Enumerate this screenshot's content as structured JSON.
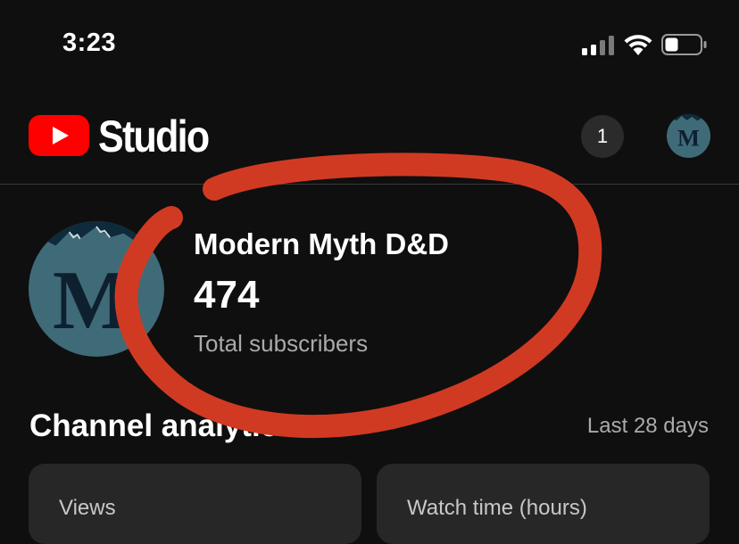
{
  "status_bar": {
    "time": "3:23"
  },
  "header": {
    "app_name": "Studio",
    "notification_count": "1",
    "avatar_letter": "M"
  },
  "channel": {
    "name": "Modern Myth D&D",
    "subscriber_count": "474",
    "subscriber_label": "Total subscribers",
    "avatar_letter": "M"
  },
  "analytics": {
    "title": "Channel analytics",
    "period": "Last 28 days",
    "cards": [
      {
        "label": "Views"
      },
      {
        "label": "Watch time (hours)"
      }
    ]
  },
  "colors": {
    "background": "#0f0f0f",
    "youtube_red": "#ff0000",
    "annotation_red": "#d13a22",
    "card_bg": "#272727",
    "avatar_teal": "#3f6b78"
  },
  "icons": [
    "signal-icon",
    "wifi-icon",
    "battery-icon",
    "youtube-logo-icon",
    "notification-badge",
    "avatar"
  ]
}
